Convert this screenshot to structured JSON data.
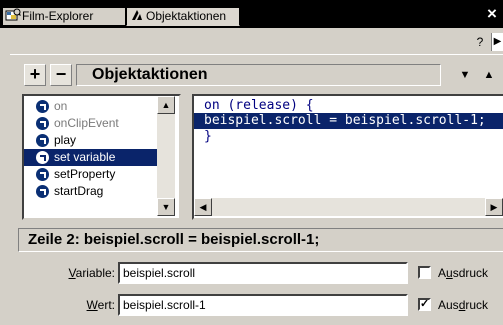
{
  "window": {
    "title": "Objektaktionen",
    "close_glyph": "×"
  },
  "tabs": [
    {
      "label": "Film-Explorer",
      "icon": "film-explorer-icon",
      "active": false
    },
    {
      "label": "Objektaktionen",
      "icon": "actions-icon",
      "active": true
    }
  ],
  "toolbar": {
    "help_glyph": "?",
    "tab_scroll_glyph": "▶",
    "add_glyph": "+",
    "remove_glyph": "−",
    "panel_title": "Objektaktionen",
    "menu_glyph": "▼",
    "collapse_glyph": "▲"
  },
  "actions_list": {
    "items": [
      {
        "label": "on",
        "dim": true,
        "selected": false
      },
      {
        "label": "onClipEvent",
        "dim": true,
        "selected": false
      },
      {
        "label": "play",
        "dim": false,
        "selected": false
      },
      {
        "label": "set variable",
        "dim": false,
        "selected": true
      },
      {
        "label": "setProperty",
        "dim": false,
        "selected": false
      },
      {
        "label": "startDrag",
        "dim": false,
        "selected": false
      }
    ],
    "scroll_up_glyph": "▲",
    "scroll_down_glyph": "▼"
  },
  "code": {
    "lines": [
      "on (release) {",
      "beispiel.scroll = beispiel.scroll-1;",
      "}"
    ],
    "selected_line": 2,
    "scroll_left_glyph": "◀",
    "scroll_right_glyph": "▶"
  },
  "status": {
    "text": "Zeile 2: beispiel.scroll = beispiel.scroll-1;"
  },
  "form": {
    "variable": {
      "label_accel": "V",
      "label_rest": "ariable:",
      "value": "beispiel.scroll",
      "expr_checked": false,
      "expr_label_pre": "A",
      "expr_label_accel": "u",
      "expr_label_post": "sdruck"
    },
    "wert": {
      "label_accel": "W",
      "label_rest": "ert:",
      "value": "beispiel.scroll-1",
      "expr_checked": true,
      "expr_label_pre": "Aus",
      "expr_label_accel": "d",
      "expr_label_post": "ruck",
      "check_glyph": "✓"
    }
  },
  "colors": {
    "selection": "#0a246a",
    "keyword": "#000080",
    "bullet": "#0a2f74",
    "dialog_bg": "#d4d0c8"
  }
}
